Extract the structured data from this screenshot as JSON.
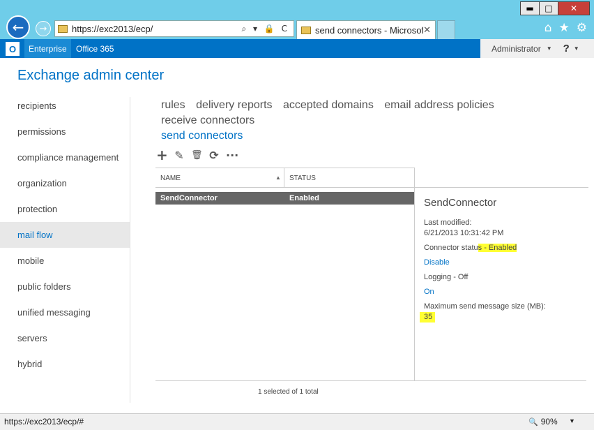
{
  "browser": {
    "window_buttons": {
      "minimize": "▬",
      "maximize": "□",
      "close": "✕"
    },
    "back_glyph": "←",
    "forward_glyph": "→",
    "address_url": "https://exc2013/ecp/",
    "address_tools": "⌕ ▾ 🔒 C",
    "tab_title": "send connectors - Microsof...",
    "tab_close": "✕",
    "toolbar_icons": {
      "home": "⌂",
      "favorites": "★",
      "tools": "⚙"
    }
  },
  "o365bar": {
    "logo": "O",
    "enterprise": "Enterprise",
    "office365": "Office 365",
    "user": "Administrator",
    "user_caret": "▼",
    "help": "?",
    "help_caret": "▼"
  },
  "eac_title": "Exchange admin center",
  "nav": {
    "items": [
      {
        "label": "recipients"
      },
      {
        "label": "permissions"
      },
      {
        "label": "compliance management"
      },
      {
        "label": "organization"
      },
      {
        "label": "protection"
      },
      {
        "label": "mail flow",
        "active": true
      },
      {
        "label": "mobile"
      },
      {
        "label": "public folders"
      },
      {
        "label": "unified messaging"
      },
      {
        "label": "servers"
      },
      {
        "label": "hybrid"
      }
    ]
  },
  "subtabs": {
    "rules": "rules",
    "delivery_reports": "delivery reports",
    "accepted_domains": "accepted domains",
    "email_address_policies": "email address policies",
    "receive_connectors": "receive connectors",
    "send_connectors": "send connectors"
  },
  "toolbar": {
    "add": "+",
    "edit": "✎",
    "delete": "🗑",
    "refresh": "⟳",
    "more": "···"
  },
  "grid": {
    "col_name": "NAME",
    "col_status": "STATUS",
    "sort_glyph": "▲",
    "rows": [
      {
        "name": "SendConnector",
        "status": "Enabled",
        "selected": true
      }
    ],
    "count": "1 selected of 1 total"
  },
  "detail": {
    "name": "SendConnector",
    "last_modified_label": "Last modified:",
    "last_modified_value": "6/21/2013 10:31:42 PM",
    "connector_status_prefix": "Connector statu",
    "connector_status_hl": "s - Enabled",
    "disable_link": "Disable",
    "logging": "Logging - Off",
    "on_link": "On",
    "max_size_label": "Maximum send message size (MB):",
    "max_size_value": "35"
  },
  "statusbar": {
    "url": "https://exc2013/ecp/#",
    "zoom_icon": "🔍",
    "zoom": "90%",
    "zoom_caret": "▼"
  },
  "colors": {
    "accent": "#0072c6",
    "chrome": "#6fcde9",
    "highlight": "#ffff33"
  }
}
